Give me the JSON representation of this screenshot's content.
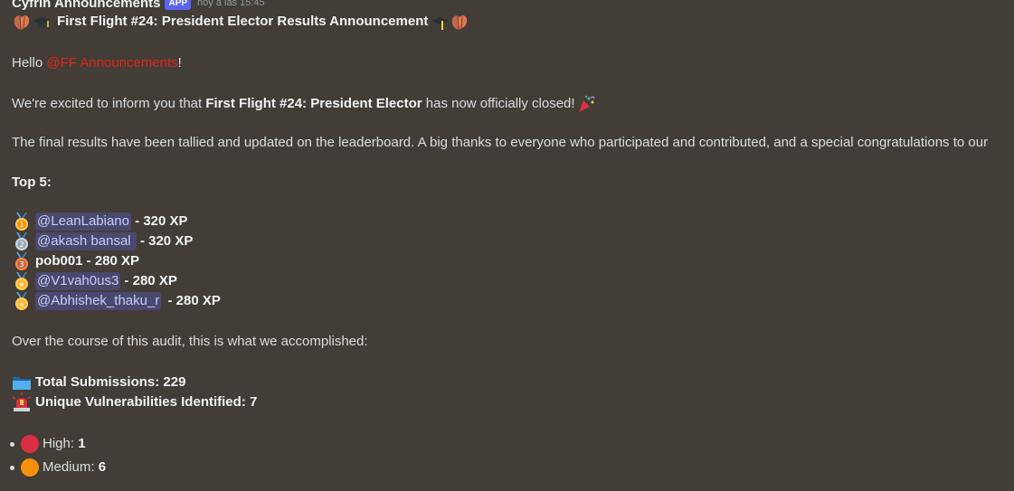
{
  "header": {
    "author": "Cyfrin Announcements",
    "badge": "APP",
    "timestamp": "hoy a las 15:45"
  },
  "title": "First Flight #24: President Elector Results Announcement",
  "greeting": {
    "prefix": "Hello ",
    "mention": "@FF Announcements",
    "suffix": "!"
  },
  "intro": {
    "before": "We're excited to inform you that ",
    "bold": "First Flight #24: President Elector",
    "after": " has now officially closed!"
  },
  "final_results": "The final results have been tallied and updated on the leaderboard. A big thanks to everyone who participated and contributed, and a special congratulations to our",
  "top_heading": "Top 5:",
  "top": [
    {
      "medal": "gold-medal-1-icon",
      "name": "@LeanLabiano",
      "mention": true,
      "xp": " - 320 XP"
    },
    {
      "medal": "silver-medal-2-icon",
      "name": "@akash bansal ",
      "mention": true,
      "xp": " - 320 XP"
    },
    {
      "medal": "bronze-medal-3-icon",
      "name": "pob001",
      "mention": false,
      "xp": " - 280 XP"
    },
    {
      "medal": "medal-icon",
      "name": "@V1vah0us3",
      "mention": true,
      "xp": " - 280 XP"
    },
    {
      "medal": "medal-icon",
      "name": "@Abhishek_thaku_r",
      "mention": true,
      "xp": " - 280 XP"
    }
  ],
  "accomplished": "Over the course of this audit, this is what we accomplished:",
  "stats": {
    "submissions_label": "Total Submissions",
    "submissions_value": ": 229",
    "vulns_label": "Unique Vulnerabilities Identified",
    "vulns_value": ": 7"
  },
  "severities": [
    {
      "label": "High: ",
      "value": "1",
      "color": "#dd2e44"
    },
    {
      "label": "Medium: ",
      "value": "6",
      "color": "#f4900c"
    }
  ]
}
